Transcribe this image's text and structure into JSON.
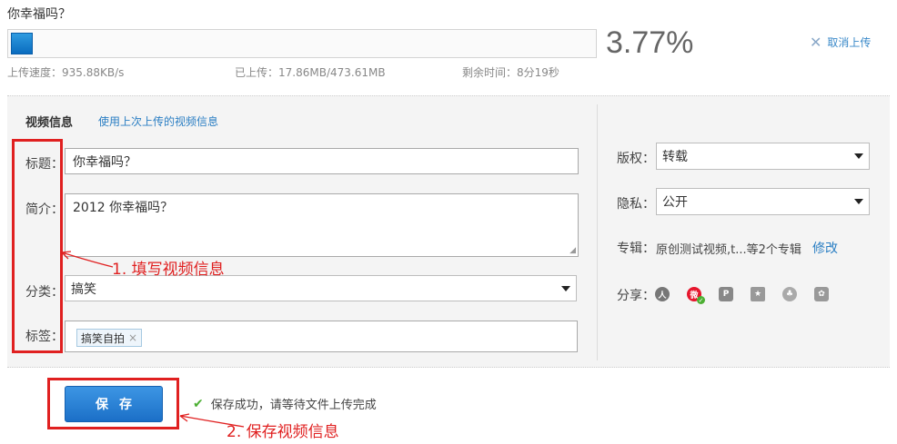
{
  "upload": {
    "file_name": "你幸福吗？",
    "progress_percent": 3.77,
    "percent_label": "3.77%",
    "cancel_label": "取消上传",
    "speed": "上传速度：935.88KB/s",
    "uploaded": "已上传：17.86MB/473.61MB",
    "remaining": "剩余时间：8分19秒"
  },
  "info": {
    "section_title": "视频信息",
    "reuse_link": "使用上次上传的视频信息",
    "title_label": "标题：",
    "title_value": "你幸福吗？",
    "desc_label": "简介：",
    "desc_value": "2012 你幸福吗？",
    "category_label": "分类：",
    "category_value": "搞笑",
    "tags_label": "标签：",
    "tags": [
      "搞笑自拍"
    ],
    "tag_remove": "×"
  },
  "side": {
    "copyright_label": "版权：",
    "copyright_value": "转载",
    "privacy_label": "隐私：",
    "privacy_value": "公开",
    "album_label": "专辑：",
    "album_value": "原创测试视频,t...等2个专辑",
    "album_edit": "修改",
    "share_label": "分享：",
    "share_icons": [
      "renren-icon",
      "weibo-icon",
      "kaixin-icon",
      "qzone-icon",
      "douban-icon",
      "tencent-icon"
    ]
  },
  "annotations": {
    "step1": "1.  填写视频信息",
    "step2": "2.  保存视频信息",
    "color": "#e02020"
  },
  "save": {
    "button_label": "保存",
    "status": "保存成功，请等待文件上传完成"
  }
}
